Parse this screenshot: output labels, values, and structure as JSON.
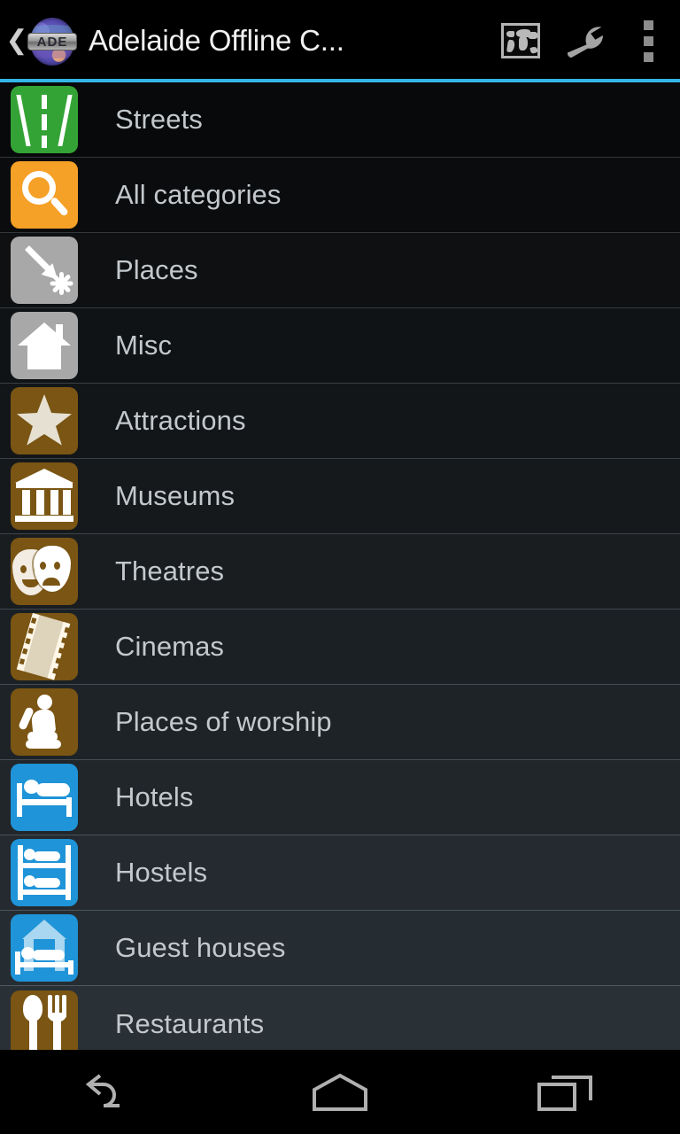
{
  "app": {
    "title": "Adelaide Offline C...",
    "logo_text": "ADE",
    "logo_icon": "globe-ade-icon"
  },
  "actionbar": {
    "back_icon": "back-chevron-icon",
    "actions": [
      {
        "name": "world-map-icon",
        "label": "Map"
      },
      {
        "name": "wrench-icon",
        "label": "Tools"
      },
      {
        "name": "overflow-menu-icon",
        "label": "More options"
      }
    ],
    "accent_color": "#33b5e5"
  },
  "list": {
    "items": [
      {
        "label": "Streets",
        "icon": "road-icon",
        "color": "#34a336"
      },
      {
        "label": "All categories",
        "icon": "magnifier-icon",
        "color": "#f5a026"
      },
      {
        "label": "Places",
        "icon": "pin-burst-icon",
        "color": "#a8a8a8"
      },
      {
        "label": "Misc",
        "icon": "house-icon",
        "color": "#a8a8a8"
      },
      {
        "label": "Attractions",
        "icon": "star-icon",
        "color": "#7a5513"
      },
      {
        "label": "Museums",
        "icon": "museum-icon",
        "color": "#7a5513"
      },
      {
        "label": "Theatres",
        "icon": "theatre-masks-icon",
        "color": "#7a5513"
      },
      {
        "label": "Cinemas",
        "icon": "film-strip-icon",
        "color": "#7a5513"
      },
      {
        "label": "Places of worship",
        "icon": "praying-person-icon",
        "color": "#7a5513"
      },
      {
        "label": "Hotels",
        "icon": "bed-icon",
        "color": "#1f94d8"
      },
      {
        "label": "Hostels",
        "icon": "bunk-bed-icon",
        "color": "#1f94d8"
      },
      {
        "label": "Guest houses",
        "icon": "guest-house-icon",
        "color": "#1f94d8"
      },
      {
        "label": "Restaurants",
        "icon": "cutlery-icon",
        "color": "#7a5513"
      }
    ]
  },
  "navbar": {
    "buttons": [
      {
        "name": "nav-back-button",
        "label": "Back"
      },
      {
        "name": "nav-home-button",
        "label": "Home"
      },
      {
        "name": "nav-recents-button",
        "label": "Recents"
      }
    ]
  }
}
